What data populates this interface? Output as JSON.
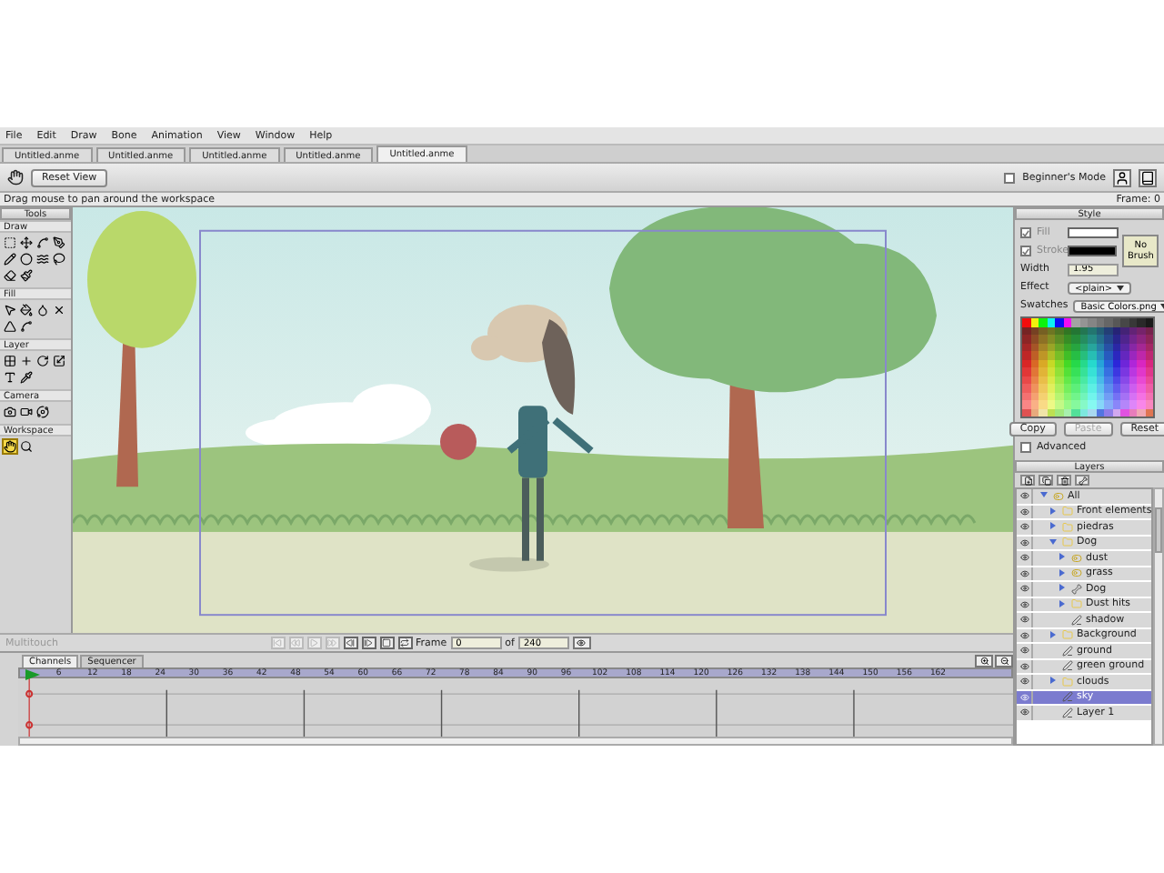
{
  "menu": [
    "File",
    "Edit",
    "Draw",
    "Bone",
    "Animation",
    "View",
    "Window",
    "Help"
  ],
  "doc_tabs": [
    {
      "label": "Untitled.anme",
      "selected": false
    },
    {
      "label": "Untitled.anme",
      "selected": false
    },
    {
      "label": "Untitled.anme",
      "selected": false
    },
    {
      "label": "Untitled.anme",
      "selected": false
    },
    {
      "label": "Untitled.anme",
      "selected": true
    }
  ],
  "toolbar": {
    "reset_view": "Reset View",
    "beginners_mode": {
      "label": "Beginner's Mode",
      "checked": false
    }
  },
  "status": "Drag mouse to pan around the workspace",
  "frame_indicator": "Frame: 0",
  "tools": {
    "title": "Tools",
    "groups": [
      {
        "label": "Draw",
        "tools": [
          {
            "selected": false
          },
          {
            "selected": false
          },
          {
            "selected": false
          },
          {
            "selected": false
          },
          {
            "selected": false
          },
          {
            "selected": false
          },
          {
            "selected": false
          },
          {
            "selected": false
          },
          {
            "selected": false
          },
          {
            "selected": false
          }
        ]
      },
      {
        "label": "Fill",
        "tools": [
          {
            "selected": false
          },
          {
            "selected": false
          },
          {
            "selected": false
          },
          {
            "selected": false
          },
          {
            "selected": false
          },
          {
            "selected": false
          }
        ]
      },
      {
        "label": "Layer",
        "tools": [
          {
            "selected": false
          },
          {
            "selected": false
          },
          {
            "selected": false
          },
          {
            "selected": false
          },
          {
            "selected": false
          },
          {
            "selected": false
          }
        ]
      },
      {
        "label": "Camera",
        "tools": [
          {
            "selected": false
          },
          {
            "selected": false
          },
          {
            "selected": false
          }
        ]
      },
      {
        "label": "Workspace",
        "tools": [
          {
            "selected": true
          },
          {
            "selected": false
          }
        ]
      }
    ]
  },
  "style": {
    "title": "Style",
    "fill": {
      "label": "Fill",
      "checked": true,
      "color": "#ffffff"
    },
    "stroke": {
      "label": "Stroke",
      "checked": true,
      "color": "#000000"
    },
    "width": {
      "label": "Width",
      "value": "1.95"
    },
    "no_brush": "No Brush",
    "effect": {
      "label": "Effect",
      "value": "<plain>"
    },
    "swatches": {
      "label": "Swatches",
      "value": "Basic Colors.png"
    },
    "buttons": [
      {
        "label": "Copy",
        "disabled": false
      },
      {
        "label": "Paste",
        "disabled": true
      },
      {
        "label": "Reset",
        "disabled": false
      }
    ],
    "advanced": {
      "label": "Advanced",
      "checked": false
    }
  },
  "layers": {
    "title": "Layers",
    "items": [
      {
        "name": "All",
        "kind": "switch",
        "expanded": true,
        "selected": false,
        "children": [
          {
            "name": "Front elements",
            "kind": "folder",
            "expanded": false,
            "selected": false
          },
          {
            "name": "piedras",
            "kind": "folder",
            "expanded": false,
            "selected": false
          },
          {
            "name": "Dog",
            "kind": "folder",
            "expanded": true,
            "selected": false,
            "children": [
              {
                "name": "dust",
                "kind": "switch",
                "expanded": false,
                "selected": false
              },
              {
                "name": "grass",
                "kind": "switch",
                "expanded": false,
                "selected": false
              },
              {
                "name": "Dog",
                "kind": "bone",
                "expanded": false,
                "selected": false
              },
              {
                "name": "Dust hits",
                "kind": "folder",
                "expanded": false,
                "selected": false
              },
              {
                "name": "shadow",
                "kind": "vector",
                "selected": false
              }
            ]
          },
          {
            "name": "Background",
            "kind": "folder",
            "expanded": false,
            "selected": false
          },
          {
            "name": "ground",
            "kind": "vector",
            "selected": false
          },
          {
            "name": "green ground",
            "kind": "vector",
            "selected": false
          },
          {
            "name": "clouds",
            "kind": "folder",
            "expanded": false,
            "selected": false
          },
          {
            "name": "sky",
            "kind": "vector",
            "selected": true
          },
          {
            "name": "Layer 1",
            "kind": "vector",
            "selected": false
          }
        ]
      }
    ]
  },
  "playback": {
    "multitouch": "Multitouch",
    "buttons": [
      {
        "disabled": true
      },
      {
        "disabled": true
      },
      {
        "disabled": true
      },
      {
        "disabled": true
      },
      {
        "disabled": false
      },
      {
        "disabled": false
      },
      {
        "disabled": false
      },
      {
        "disabled": false
      }
    ],
    "frame_label": "Frame",
    "frame": "0",
    "of_label": "of",
    "end_frame": "240"
  },
  "timeline": {
    "tabs": [
      {
        "label": "Channels",
        "selected": true
      },
      {
        "label": "Sequencer",
        "selected": false
      }
    ],
    "ruler": [
      "6",
      "12",
      "18",
      "24",
      "30",
      "36",
      "42",
      "48",
      "54",
      "60",
      "66",
      "72",
      "78",
      "84",
      "90",
      "96",
      "102",
      "108",
      "114",
      "120",
      "126",
      "132",
      "138",
      "144",
      "150",
      "156",
      "162"
    ]
  }
}
